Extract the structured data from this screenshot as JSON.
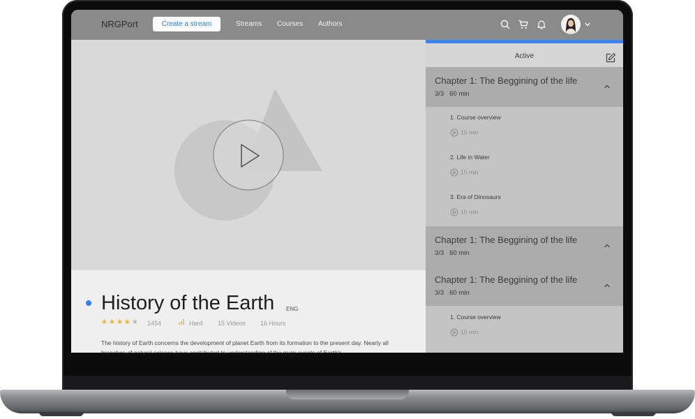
{
  "header": {
    "logo": "NRGPort",
    "create_button": "Create a stream",
    "nav": [
      "Streams",
      "Courses",
      "Authors"
    ],
    "icons": [
      "search-icon",
      "cart-icon",
      "bell-icon",
      "chevron-down-icon"
    ]
  },
  "course": {
    "title": "History of the Earth",
    "language": "ENG",
    "rating_stars": 4,
    "rating_count": "1454",
    "difficulty": "Hard",
    "videos": "15 Videos",
    "hours": "16 Hours",
    "description": "The history of Earth concerns the development of planet Earth from its formation to the present day. Nearly all branches of natural science have contributed to understanding of the main events of Earth's"
  },
  "sidebar": {
    "active_label": "Active",
    "chapters": [
      {
        "title": "Chapter 1: The Beggining of the life",
        "progress": "3/3",
        "duration": "60 min",
        "lessons": [
          {
            "title": "1. Course overview",
            "time": "15 min"
          },
          {
            "title": "2. Life in Water",
            "time": "15 min"
          },
          {
            "title": "3. Era of Dinosaurs",
            "time": "15 min"
          }
        ]
      },
      {
        "title": "Chapter 1: The Beggining of the life",
        "progress": "3/3",
        "duration": "60 min",
        "lessons": []
      },
      {
        "title": "Chapter 1: The Beggining of the life",
        "progress": "3/3",
        "duration": "60 min",
        "lessons": [
          {
            "title": "1. Course overview",
            "time": "15 min"
          }
        ]
      }
    ]
  },
  "colors": {
    "accent": "#2f7ef5",
    "topbar": "#8a8a8a",
    "star": "#f0b524"
  }
}
